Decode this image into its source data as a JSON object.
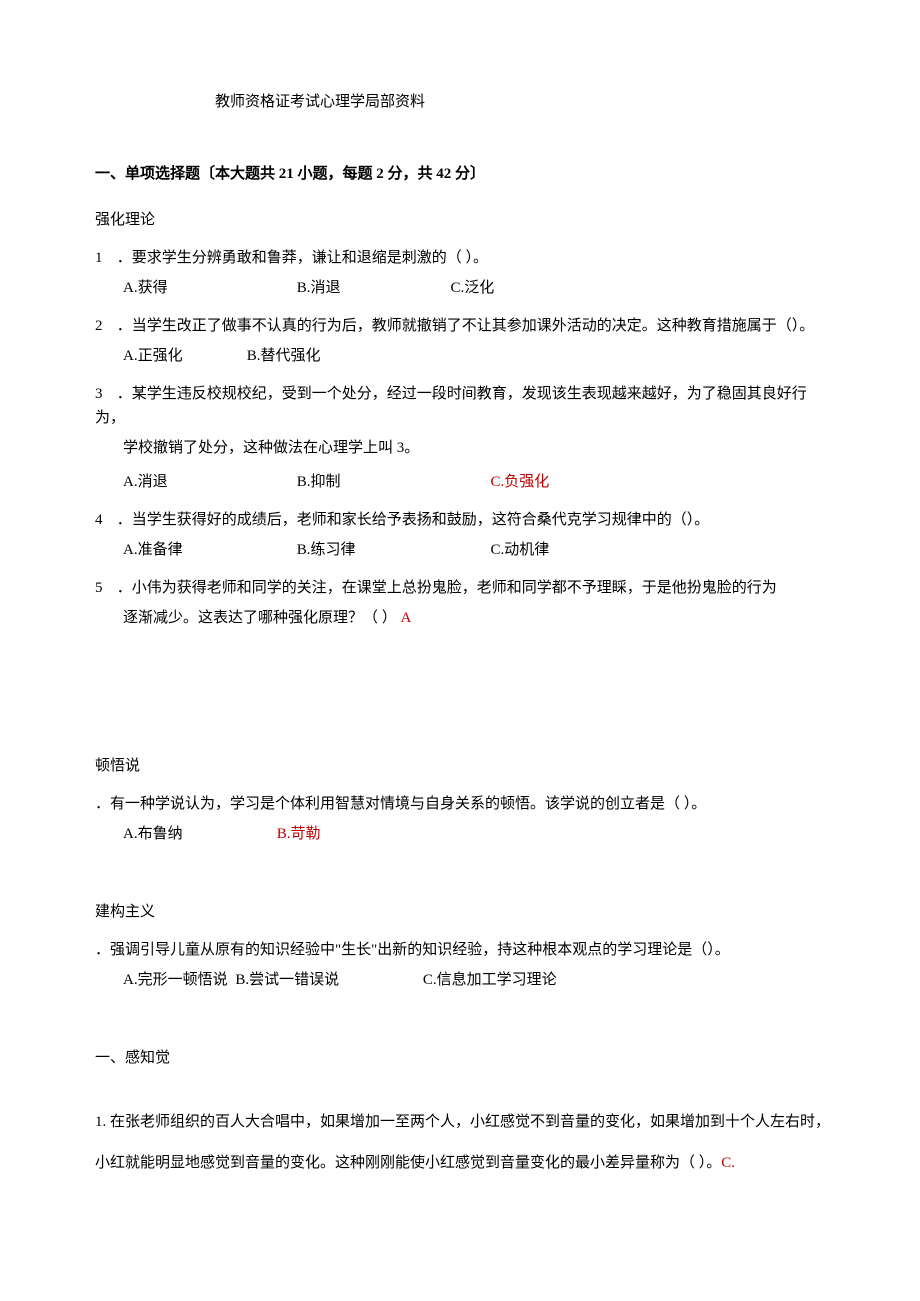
{
  "title": "教师资格证考试心理学局部资料",
  "section1": {
    "heading": "一、单项选择题〔本大题共 21 小题，每题 2 分，共 42 分〕",
    "topic1": "强化理论",
    "q1": {
      "num": "1",
      "stem": "．要求学生分辨勇敢和鲁莽，谦让和退缩是刺激的（            ）。",
      "a": "A.获得",
      "b": "B.消退",
      "c": "C.泛化"
    },
    "q2": {
      "num": "2",
      "stem": "．当学生改正了做事不认真的行为后，教师就撤销了不让其参加课外活动的决定。这种教育措施属于（）。",
      "a": "A.正强化",
      "b": "B.替代强化"
    },
    "q3": {
      "num": "3",
      "stem1": "．某学生违反校规校纪，受到一个处分，经过一段时间教育，发现该生表现越来越好，为了稳固其良好行为，",
      "stem2": "学校撤销了处分，这种做法在心理学上叫 3。",
      "a": "A.消退",
      "b": "B.抑制",
      "c": "C.负强化"
    },
    "q4": {
      "num": "4",
      "stem": "．当学生获得好的成绩后，老师和家长给予表扬和鼓励，这符合桑代克学习规律中的（）。",
      "a": "A.准备律",
      "b": "B.练习律",
      "c": "C.动机律"
    },
    "q5": {
      "num": "5",
      "stem1": "．小伟为获得老师和同学的关注，在课堂上总扮鬼脸，老师和同学都不予理睬，于是他扮鬼脸的行为",
      "stem2": "逐渐减少。这表达了哪种强化原理？（            ）",
      "ans": "A"
    },
    "topic2": "顿悟说",
    "q6": {
      "stem": "．有一种学说认为，学习是个体利用智慧对情境与自身关系的顿悟。该学说的创立者是（                    ）。",
      "a": "A.布鲁纳",
      "b": "B.苛勒"
    },
    "topic3": "建构主义",
    "q7": {
      "stem": "．强调引导儿童从原有的知识经验中\"生长\"出新的知识经验，持这种根本观点的学习理论是（）。",
      "a": "A.完形一顿悟说",
      "b": "B.尝试一错误说",
      "c": "C.信息加工学习理论"
    }
  },
  "section2": {
    "heading": "一、感知觉",
    "q1": {
      "num": "1.",
      "line1": " 在张老师组织的百人大合唱中，如果增加一至两个人，小红感觉不到音量的变化，如果增加到十个人左右时，",
      "line2": "小红就能明显地感觉到音量的变化。这种刚刚能使小红感觉到音量变化的最小差异量称为（     ）。",
      "ans": "C."
    }
  }
}
